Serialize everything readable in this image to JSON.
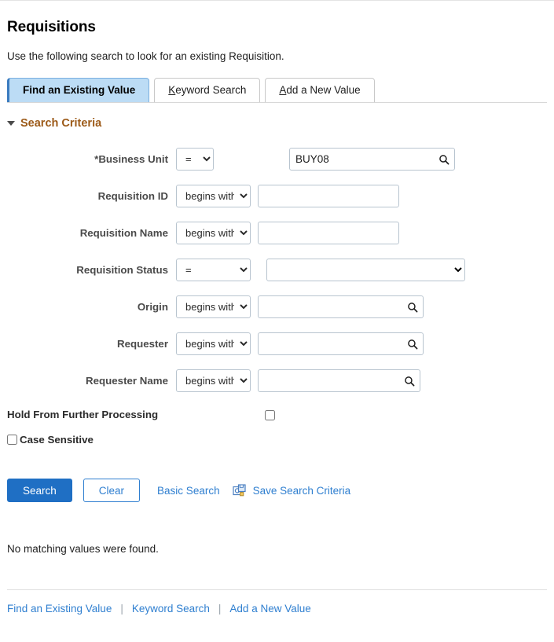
{
  "page": {
    "title": "Requisitions",
    "subtitle": "Use the following search to look for an existing Requisition."
  },
  "tabs": [
    {
      "label": "Find an Existing Value",
      "active": true
    },
    {
      "label": "Keyword Search",
      "active": false
    },
    {
      "label": "Add a New Value",
      "active": false
    }
  ],
  "section": {
    "title": "Search Criteria",
    "caret_icon": "caret-down-icon"
  },
  "criteria": {
    "rows": [
      {
        "label": "*Business Unit",
        "operator": "=",
        "value": "BUY08",
        "placeholder": "",
        "has_lookup": true,
        "control": "input"
      },
      {
        "label": "Requisition ID",
        "operator": "begins with",
        "value": "",
        "placeholder": "",
        "has_lookup": false,
        "control": "input"
      },
      {
        "label": "Requisition Name",
        "operator": "begins with",
        "value": "",
        "placeholder": "",
        "has_lookup": false,
        "control": "input"
      },
      {
        "label": "Requisition Status",
        "operator": "=",
        "value": "",
        "placeholder": "",
        "has_lookup": false,
        "control": "select"
      },
      {
        "label": "Origin",
        "operator": "begins with",
        "value": "",
        "placeholder": "",
        "has_lookup": true,
        "control": "input"
      },
      {
        "label": "Requester",
        "operator": "begins with",
        "value": "",
        "placeholder": "",
        "has_lookup": true,
        "control": "input"
      },
      {
        "label": "Requester Name",
        "operator": "begins with",
        "value": "",
        "placeholder": "",
        "has_lookup": true,
        "control": "input"
      }
    ],
    "hold_label": "Hold From Further Processing",
    "hold_checked": false,
    "case_sensitive_label": "Case Sensitive",
    "case_sensitive_checked": false
  },
  "actions": {
    "search_label": "Search",
    "clear_label": "Clear",
    "basic_search_label": "Basic Search",
    "save_criteria_label": "Save Search Criteria",
    "save_icon": "save-search-icon"
  },
  "result": {
    "message": "No matching values were found."
  },
  "footer": {
    "links": [
      "Find an Existing Value",
      "Keyword Search",
      "Add a New Value"
    ],
    "separator": "|"
  },
  "colors": {
    "accent_blue": "#1f6fc4",
    "link_blue": "#2f7fd0",
    "active_tab_bg": "#bcdcf5",
    "section_brown": "#9c5a18"
  }
}
